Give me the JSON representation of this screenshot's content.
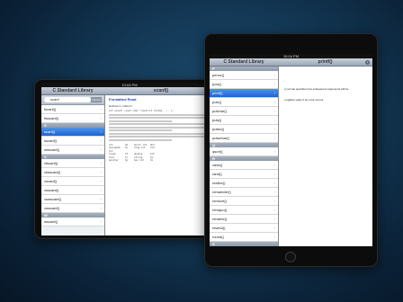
{
  "landscape": {
    "status_time": "10:04 PM",
    "left_title": "C Standard Library",
    "right_title": "scanf()",
    "search": {
      "value": "scanf",
      "cancel_label": "Cancel"
    },
    "list": [
      {
        "label": "fscanf()",
        "selected": false
      },
      {
        "label": "fwscanf()",
        "selected": false
      },
      {
        "section": "S"
      },
      {
        "label": "scanf()",
        "selected": true
      },
      {
        "label": "sscanf()",
        "selected": false
      },
      {
        "label": "swscanf()",
        "selected": false
      },
      {
        "section": "V"
      },
      {
        "label": "vfscanf()",
        "selected": false
      },
      {
        "label": "vfwscanf()",
        "selected": false
      },
      {
        "label": "vscanf()",
        "selected": false
      },
      {
        "label": "vsscanf()",
        "selected": false
      },
      {
        "label": "vswscanf()",
        "selected": false
      },
      {
        "label": "vwscanf()",
        "selected": false
      },
      {
        "section": "W"
      },
      {
        "label": "wscanf()",
        "selected": false
      }
    ],
    "doc": {
      "heading": "Formatted Read",
      "defined_in": "Defined in <stdio.h>",
      "code": [
        "int scanf( const char *restrict format, ... );",
        "",
        "Reads input from stdin. Reads the data from the",
        "input stream and stores the results..."
      ],
      "body_lines": 9,
      "table": [
        [
          "int",
          "%d",
          "short int",
          "%hd"
        ],
        [
          "unsigned int",
          "%u",
          "long int",
          "%ld"
        ],
        [
          "float",
          "%f",
          "double",
          "%lf"
        ],
        [
          "char",
          "%c",
          "string",
          "%s"
        ],
        [
          "pointer",
          "%p",
          "hex int",
          "%x"
        ]
      ]
    }
  },
  "portrait": {
    "status_time": "10:04 PM",
    "left_title": "C Standard Library",
    "right_title": "printf()",
    "list": [
      {
        "section": "P"
      },
      {
        "label": "perror()",
        "selected": false
      },
      {
        "label": "pow()",
        "selected": false
      },
      {
        "label": "printf()",
        "selected": true
      },
      {
        "label": "putc()",
        "selected": false
      },
      {
        "label": "putchar()",
        "selected": false
      },
      {
        "label": "puts()",
        "selected": false
      },
      {
        "label": "putwc()",
        "selected": false
      },
      {
        "label": "putwchar()",
        "selected": false
      },
      {
        "section": "Q"
      },
      {
        "label": "qsort()",
        "selected": false
      },
      {
        "section": "R"
      },
      {
        "label": "raise()",
        "selected": false
      },
      {
        "label": "rand()",
        "selected": false
      },
      {
        "label": "realloc()",
        "selected": false
      },
      {
        "label": "remainder()",
        "selected": false
      },
      {
        "label": "remove()",
        "selected": false
      },
      {
        "label": "remquo()",
        "selected": false
      },
      {
        "label": "rename()",
        "selected": false
      },
      {
        "label": "rewind()",
        "selected": false
      },
      {
        "label": "round()",
        "selected": false
      },
      {
        "section": "S"
      },
      {
        "label": "scalbln()",
        "selected": false
      }
    ],
    "doc": {
      "line1": "...",
      "line2": "...ly format specifies how subsequent arguments will be",
      "line3": "...negative value if an error occurs."
    }
  }
}
